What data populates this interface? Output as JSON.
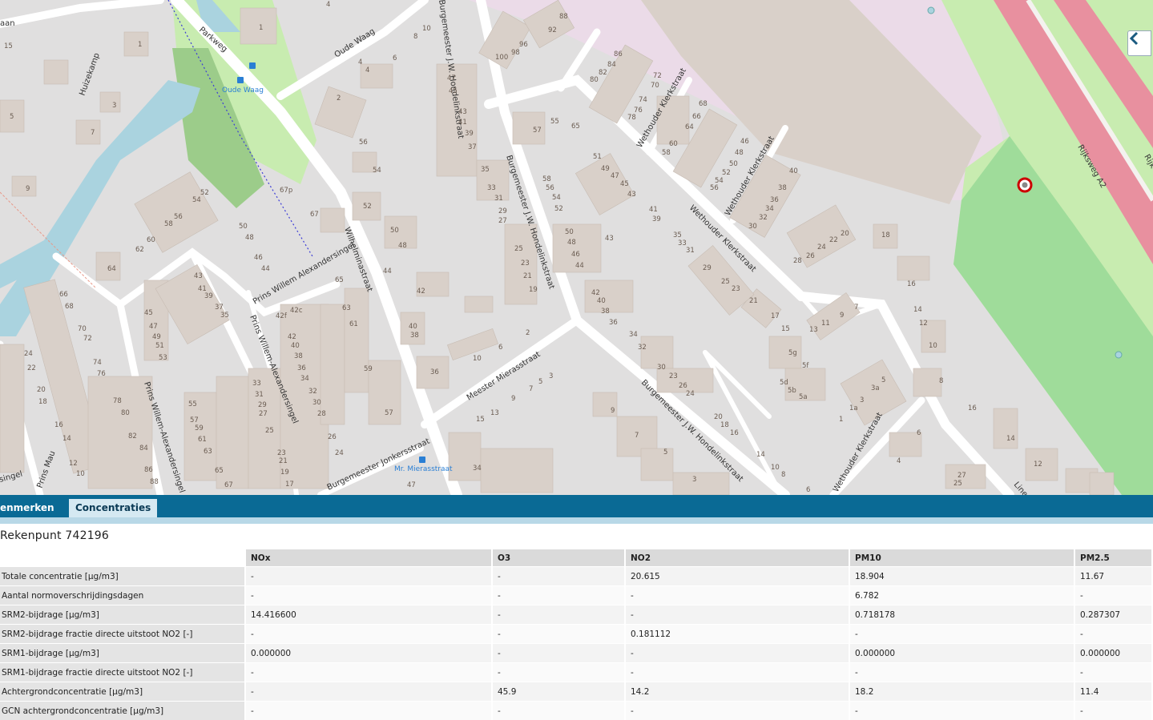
{
  "map": {
    "streets": [
      "Parkweg",
      "Oude Waag",
      "Huizekamp",
      "aan",
      "Wilhelminastraat",
      "Burgemeester J.W. Hondelinkstraat",
      "Wethouder Klerkstraat",
      "Prins Willem Alexandersingel",
      "Meester Mierasstraat",
      "Burgemeester Jonkersstraat",
      "Rijksweg A2",
      "Prins Mau",
      "singel",
      "Line",
      "Rijk"
    ],
    "pois": [
      "Oude Waag",
      "Mr. Mierasstraat"
    ],
    "house_numbers": [
      "15",
      "1",
      "5",
      "3",
      "7",
      "9",
      "4",
      "2",
      "10",
      "47",
      "45",
      "43",
      "41",
      "39",
      "37",
      "35",
      "33",
      "31",
      "29",
      "27",
      "25",
      "23",
      "21",
      "19",
      "17",
      "88",
      "92",
      "96",
      "98",
      "100",
      "86",
      "84",
      "82",
      "80",
      "72",
      "70",
      "74",
      "76",
      "78",
      "68",
      "66",
      "64",
      "62",
      "60",
      "58",
      "56",
      "54",
      "52",
      "50",
      "48",
      "46",
      "44",
      "40",
      "42",
      "36",
      "34",
      "32",
      "30",
      "28",
      "26",
      "24",
      "22",
      "20",
      "18",
      "16",
      "14",
      "12",
      "8",
      "6",
      "55",
      "57",
      "51",
      "49",
      "13",
      "11",
      "67",
      "67p",
      "65",
      "63",
      "61",
      "59",
      "42c",
      "42f",
      "38",
      "6",
      "10",
      "2"
    ],
    "marker": "selected-receptor"
  },
  "panel": {
    "tabs": [
      {
        "label": "Kenmerken",
        "visible_label": "enmerken",
        "active": false
      },
      {
        "label": "Concentraties",
        "active": true
      }
    ],
    "title": "Rekenpunt 742196",
    "columns": [
      "NOx",
      "O3",
      "NO2",
      "PM10",
      "PM2.5"
    ],
    "rows": [
      {
        "label": "Totale concentratie [µg/m3]",
        "values": [
          "-",
          "-",
          "20.615",
          "18.904",
          "11.67"
        ]
      },
      {
        "label": "Aantal normoverschrijdingsdagen",
        "values": [
          "-",
          "-",
          "-",
          "6.782",
          "-"
        ]
      },
      {
        "label": "SRM2-bijdrage [µg/m3]",
        "values": [
          "14.416600",
          "-",
          "-",
          "0.718178",
          "0.287307"
        ]
      },
      {
        "label": "SRM2-bijdrage fractie directe uitstoot NO2 [-]",
        "values": [
          "-",
          "-",
          "0.181112",
          "-",
          "-"
        ]
      },
      {
        "label": "SRM1-bijdrage [µg/m3]",
        "values": [
          "0.000000",
          "-",
          "-",
          "0.000000",
          "0.000000"
        ]
      },
      {
        "label": "SRM1-bijdrage fractie directe uitstoot NO2 [-]",
        "values": [
          "-",
          "-",
          "-",
          "-",
          "-"
        ]
      },
      {
        "label": "Achtergrondconcentratie [µg/m3]",
        "values": [
          "-",
          "45.9",
          "14.2",
          "18.2",
          "11.4"
        ]
      },
      {
        "label": "GCN achtergrondconcentratie [µg/m3]",
        "values": [
          "-",
          "-",
          "-",
          "-",
          "-"
        ]
      }
    ]
  },
  "colors": {
    "tabbar": "#0a6a95",
    "motorway": "#e8909f",
    "park": "#b3e0a6",
    "water": "#aad3df",
    "industrial": "#ebdbe8",
    "building": "#d9d0c9"
  }
}
